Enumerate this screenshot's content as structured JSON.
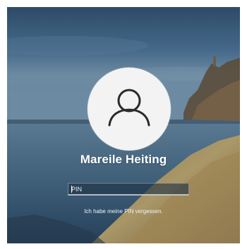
{
  "lock_screen": {
    "user_name": "Mareile Heiting",
    "avatar_icon": "user-icon",
    "pin_field": {
      "placeholder": "PIN",
      "value": ""
    },
    "forgot_pin_link": "Ich habe meine PIN vergessen."
  },
  "colors": {
    "avatar_background": "#f3f3f3",
    "avatar_glyph": "#2b2b2b",
    "text": "#ffffff"
  }
}
